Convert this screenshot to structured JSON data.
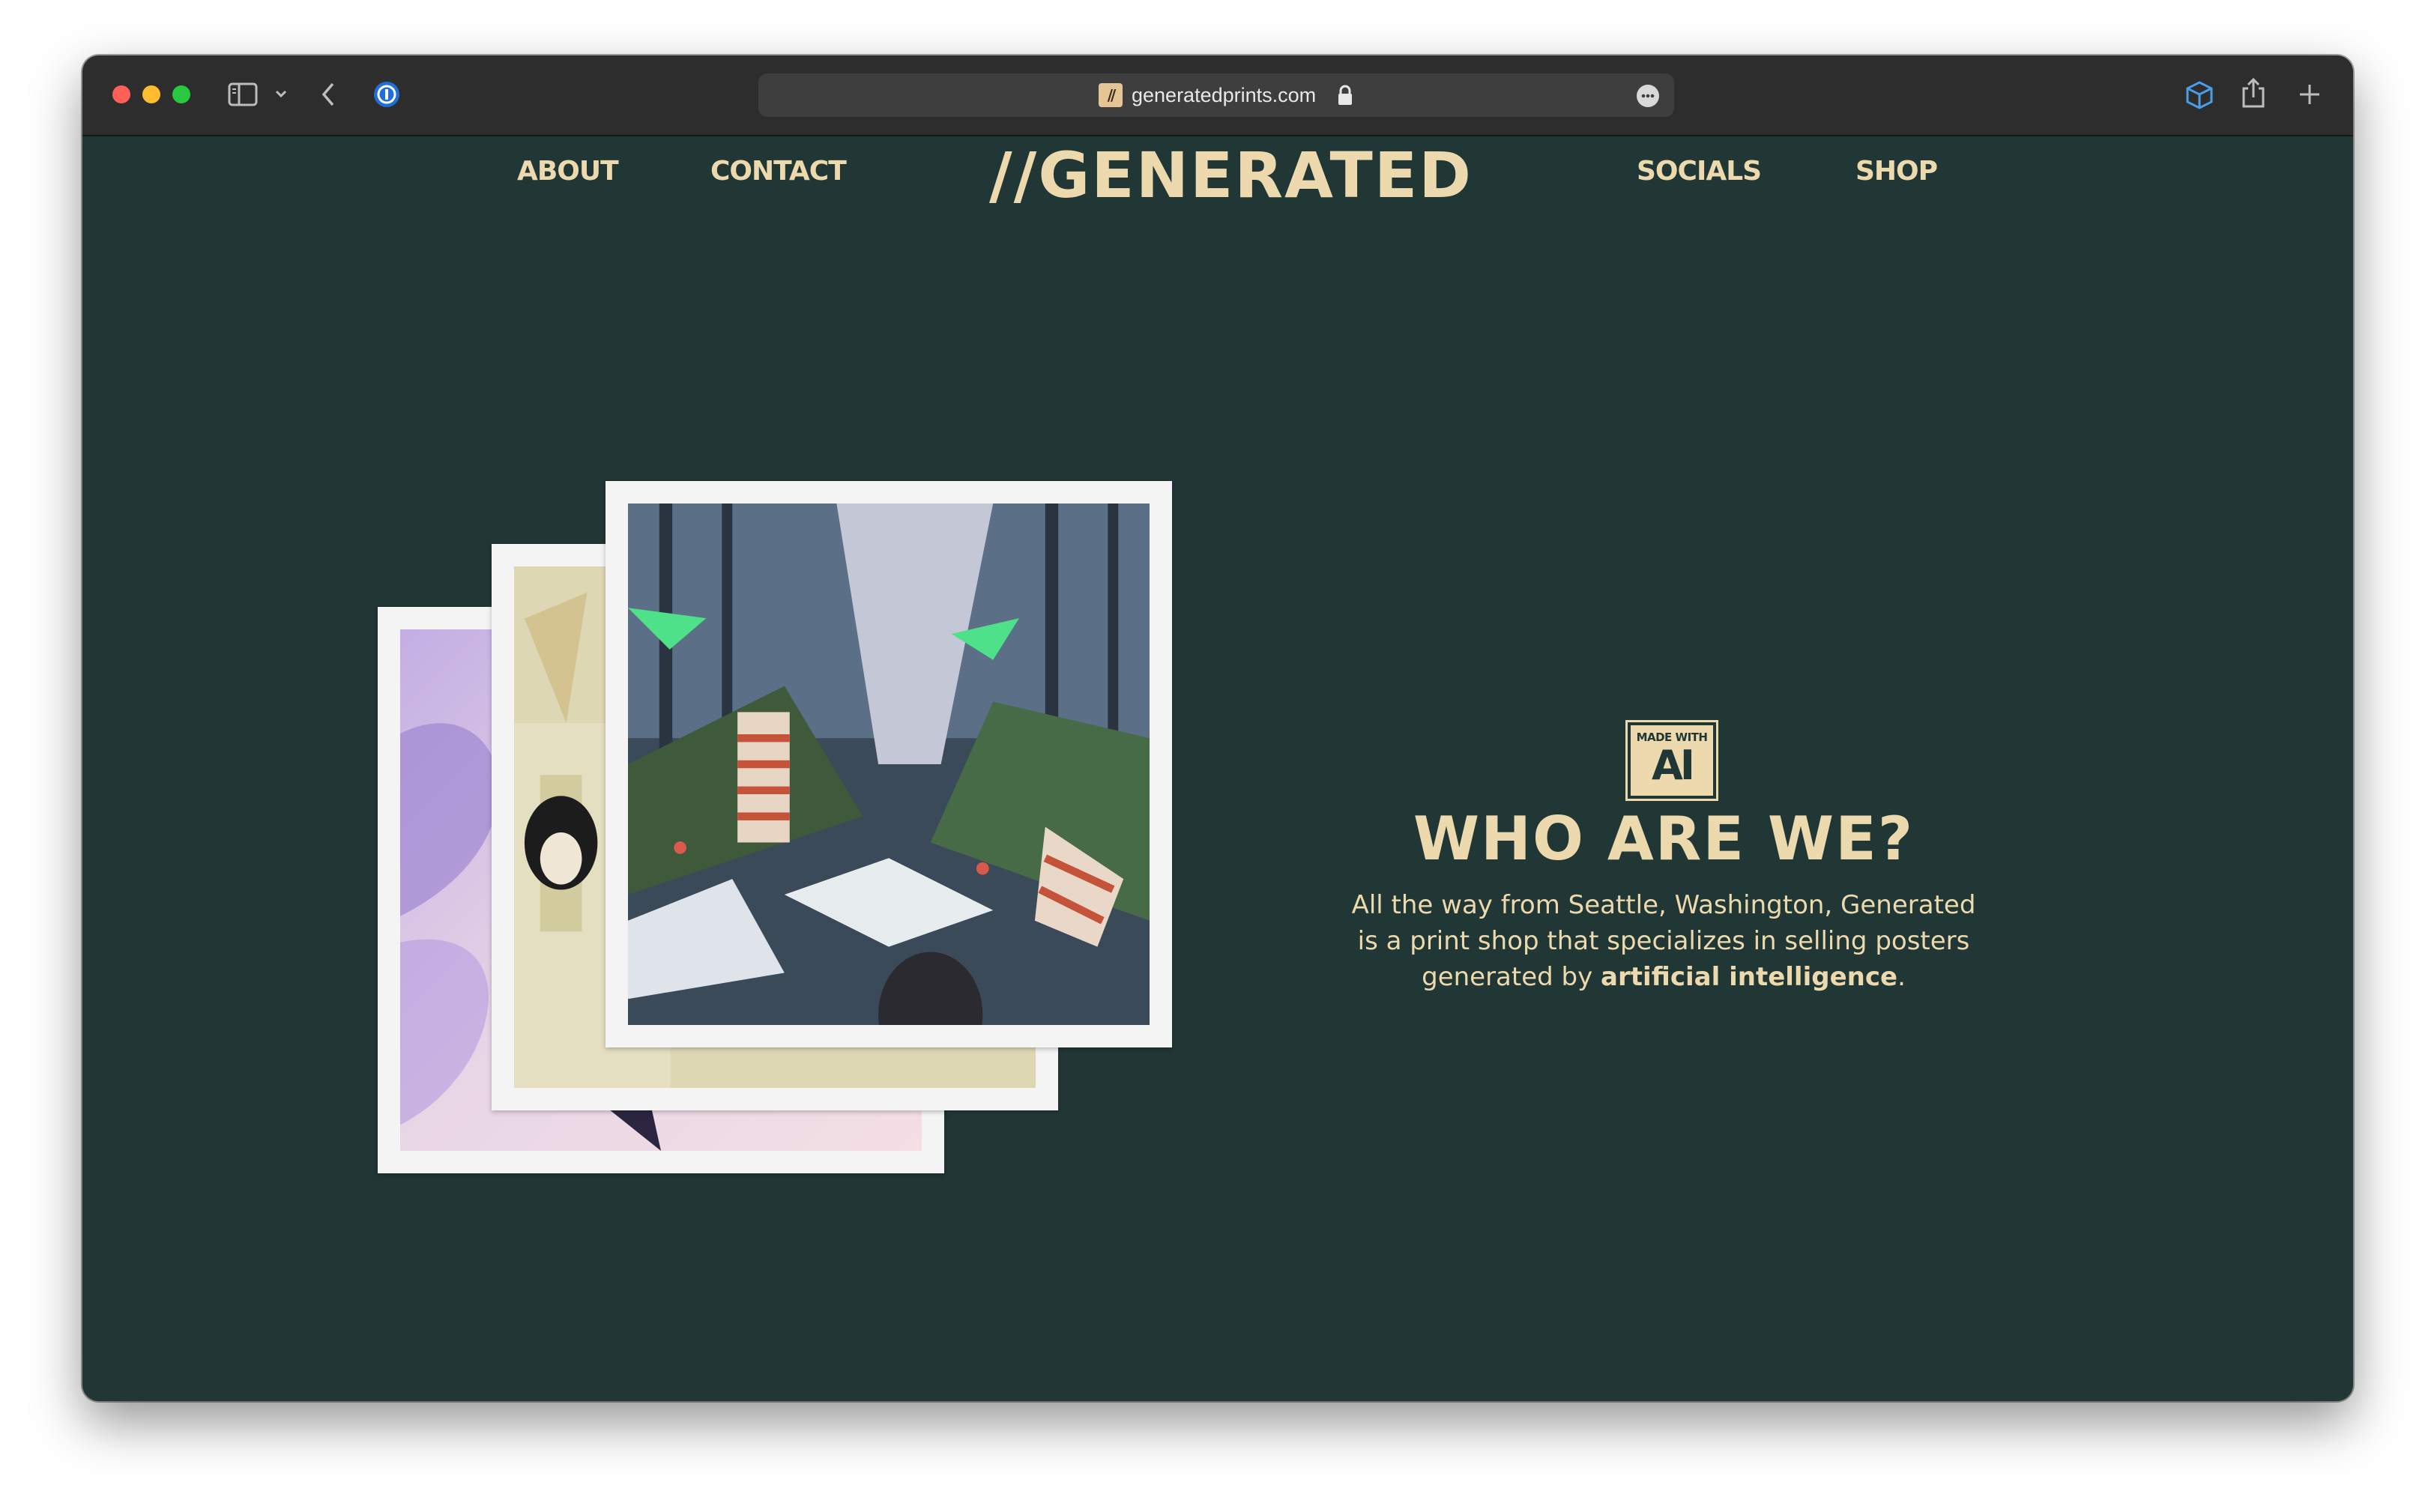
{
  "browser": {
    "url": "generatedprints.com",
    "favicon_text": "//"
  },
  "nav": {
    "about": "ABOUT",
    "contact": "CONTACT",
    "logo": "//GENERATED",
    "socials": "SOCIALS",
    "shop": "SHOP"
  },
  "hero": {
    "badge_top": "MADE WITH",
    "badge_bottom": "AI",
    "heading": "WHO ARE WE?",
    "line1": "All the way from Seattle, Washington, Generated",
    "line2": "is a print shop that specializes in selling posters",
    "line3_prefix": "generated by ",
    "line3_bold": "artificial intelligence",
    "line3_suffix": "."
  },
  "colors": {
    "page_bg": "#213735",
    "accent": "#ecd9ad",
    "frame": "#f4f4f4",
    "titlebar": "#2d2d2d"
  },
  "icons": [
    "close-light",
    "minimize-light",
    "zoom-light",
    "sidebar-icon",
    "chevron-down-icon",
    "back-icon",
    "password-manager-icon",
    "lock-icon",
    "more-icon",
    "cube-icon",
    "share-icon",
    "plus-icon"
  ]
}
